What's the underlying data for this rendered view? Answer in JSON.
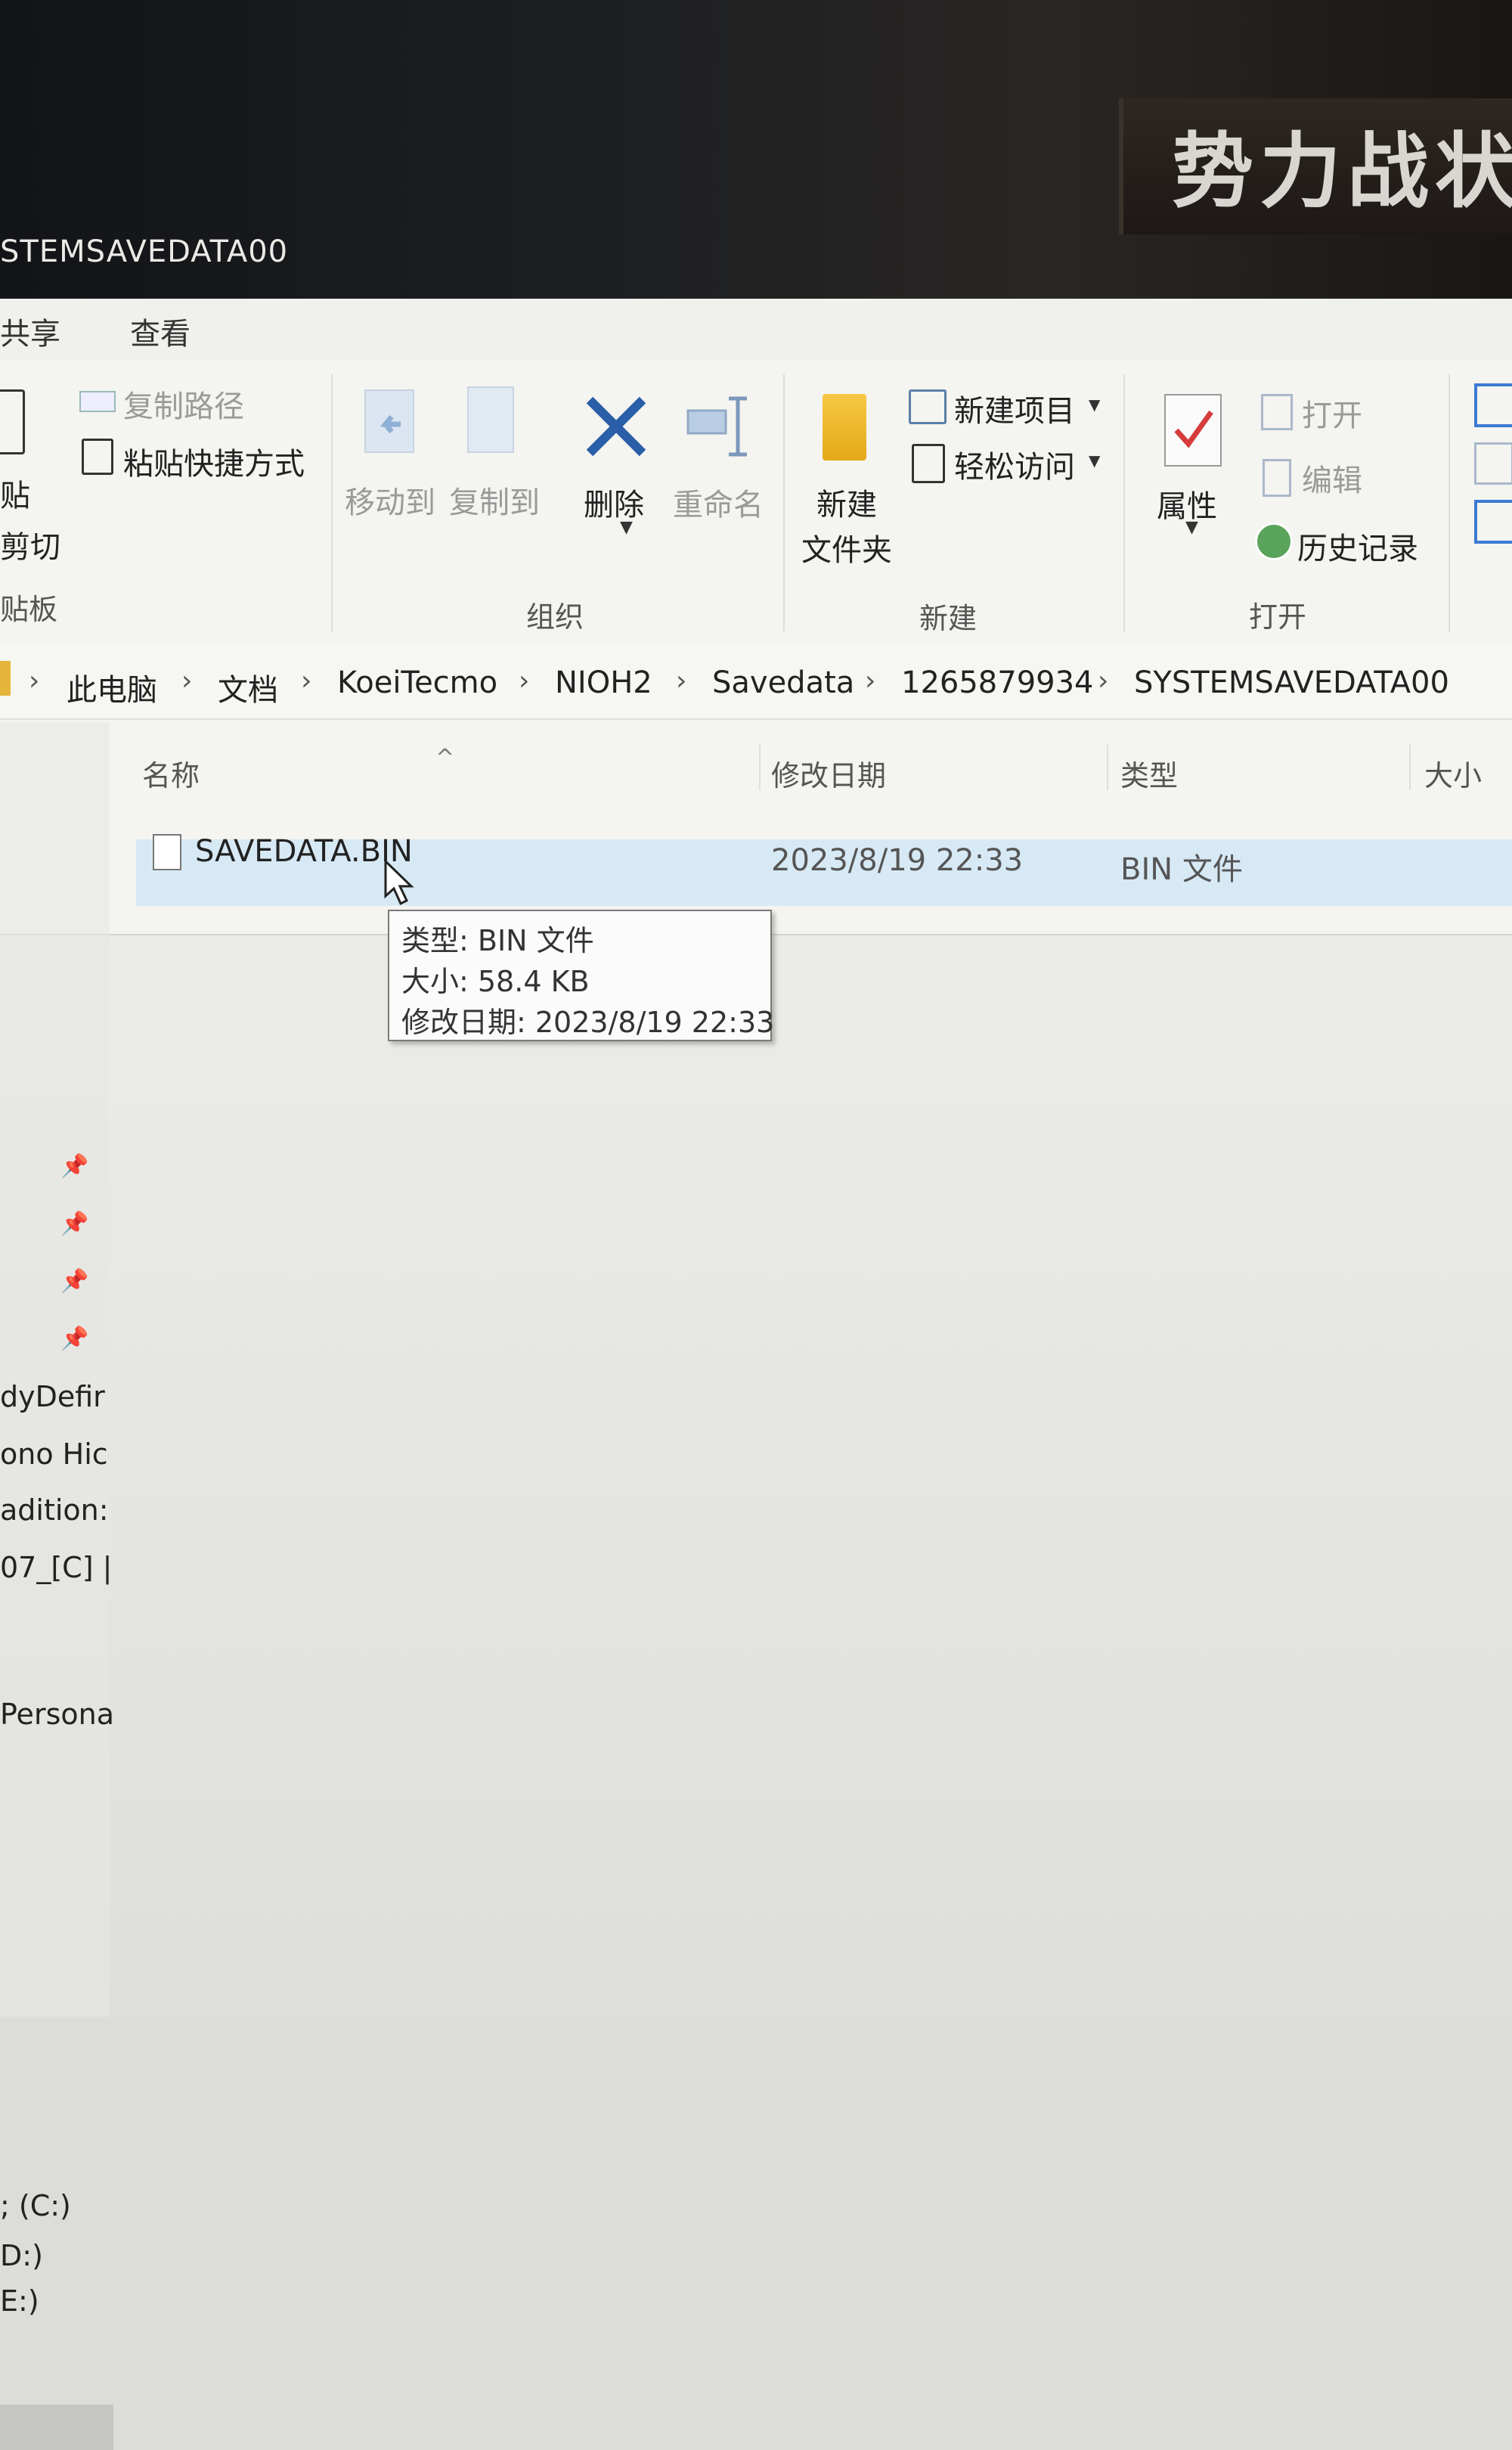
{
  "background": {
    "banner_text": "势力战状",
    "window_title": "STEMSAVEDATA00"
  },
  "ribbon_tabs": [
    "共享",
    "查看"
  ],
  "ribbon": {
    "clipboard": {
      "copy_path": "复制路径",
      "paste_shortcut": "粘贴快捷方式",
      "paste": "贴",
      "cut": "剪切",
      "group_label": "贴板"
    },
    "organize": {
      "move_to": "移动到",
      "copy_to": "复制到",
      "delete": "删除",
      "rename": "重命名",
      "group_label": "组织"
    },
    "new": {
      "new_folder_line1": "新建",
      "new_folder_line2": "文件夹",
      "new_item": "新建项目",
      "easy_access": "轻松访问",
      "group_label": "新建"
    },
    "open": {
      "properties": "属性",
      "open": "打开",
      "edit": "编辑",
      "history": "历史记录",
      "group_label": "打开"
    }
  },
  "breadcrumb": [
    "此电脑",
    "文档",
    "KoeiTecmo",
    "NIOH2",
    "Savedata",
    "1265879934",
    "SYSTEMSAVEDATA00"
  ],
  "columns": {
    "name": "名称",
    "modified": "修改日期",
    "type": "类型",
    "size": "大小"
  },
  "files": [
    {
      "name": "SAVEDATA.BIN",
      "modified": "2023/8/19 22:33",
      "type": "BIN 文件"
    }
  ],
  "tooltip": {
    "type": "类型: BIN 文件",
    "size": "大小: 58.4 KB",
    "modified": "修改日期: 2023/8/19 22:33"
  },
  "nav_items": [
    "dyDefir",
    "ono Hic",
    "adition:",
    "07_[C] |",
    "Persona",
    "; (C:)",
    "D:)",
    "E:)"
  ]
}
